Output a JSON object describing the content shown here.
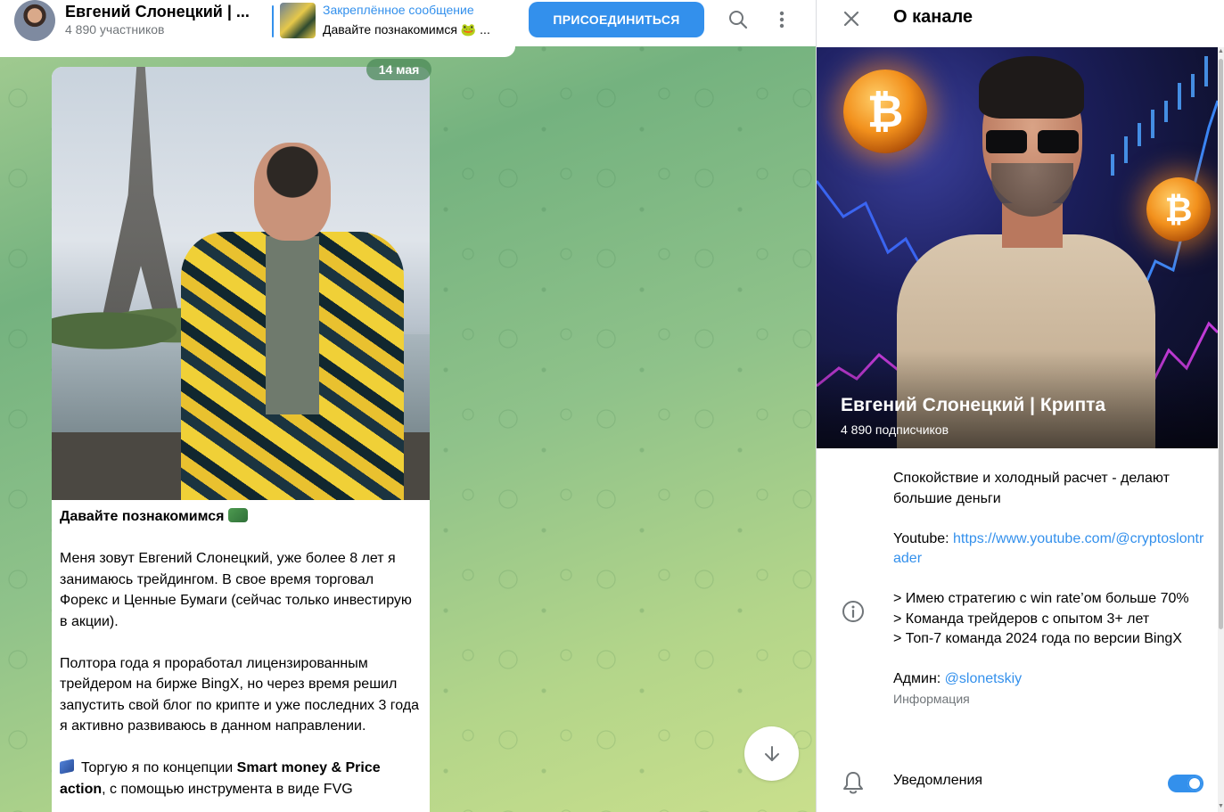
{
  "chat": {
    "header": {
      "title": "Евгений Слонецкий | ...",
      "subtitle": "4 890 участников",
      "pinned": {
        "title": "Закреплённое сообщение",
        "text": "Давайте познакомимся 🐸 ..."
      },
      "join_label": "ПРИСОЕДИНИТЬСЯ",
      "icons": [
        "search-icon",
        "more-vertical-icon"
      ]
    },
    "message": {
      "date": "14 мая",
      "heading": "Давайте познакомимся",
      "paragraph1": "Меня зовут Евгений Слонецкий, уже более 8 лет я занимаюсь трейдингом. В свое время торговал Форекс и Ценные Бумаги (сейчас только инвестирую в акции).",
      "paragraph2": "Полтора года я проработал лицензированным трейдером на бирже BingX, но через время решил запустить свой блог по крипте и уже последних 3 года я активно развиваюсь в данном направлении.",
      "paragraph3_prefix": "Торгую я по концепции ",
      "paragraph3_bold": "Smart money & Price action",
      "paragraph3_suffix": ", с помощью инструмента в виде FVG"
    },
    "scroll_down_icon": "arrow-down-icon"
  },
  "panel": {
    "title": "О канале",
    "close_icon": "close-icon",
    "cover": {
      "name": "Евгений Слонецкий | Крипта",
      "subscribers": "4 890 подписчиков",
      "coin_symbol": "₿"
    },
    "description": {
      "line1": "Спокойствие и холодный расчет - делают большие деньги",
      "youtube_label": "Youtube: ",
      "youtube_link": "https://www.youtube.com/@cryptoslontrader",
      "bullet1": "> Имею стратегию с win rate’ом больше 70%",
      "bullet2": "> Команда трейдеров с опытом 3+ лет",
      "bullet3": "> Топ-7 команда 2024 года по версии BingX",
      "admin_label": "Админ: ",
      "admin_link": "@slonetskiy",
      "info_label": "Информация"
    },
    "notifications": {
      "label": "Уведомления",
      "enabled": true
    },
    "accent_color": "#3390ec"
  }
}
